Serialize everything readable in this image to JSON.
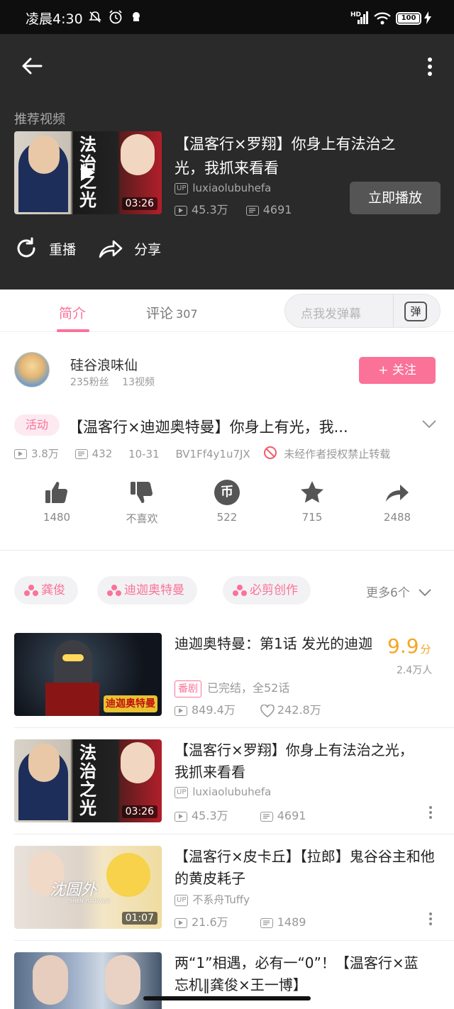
{
  "status_bar": {
    "time": "凌晨4:30",
    "network": "HD",
    "battery": "100"
  },
  "player": {
    "recommended_label": "推荐视频",
    "recommended_video": {
      "title": "【温客行×罗翔】你身上有法治之光，我抓来看看",
      "uploader": "luxiaolubuhefa",
      "views": "45.3万",
      "danmaku": "4691",
      "duration": "03:26",
      "thumb_text": "法治之光"
    },
    "play_now_label": "立即播放",
    "replay_label": "重播",
    "share_label": "分享"
  },
  "tabs": {
    "intro_label": "简介",
    "comments_label": "评论",
    "comments_count": "307",
    "danmaku_placeholder": "点我发弹幕",
    "danmaku_icon_text": "弹"
  },
  "uploader": {
    "name": "硅谷浪味仙",
    "fans": "235粉丝",
    "videos": "13视频",
    "follow_label": "+ 关注"
  },
  "video": {
    "activity_badge": "活动",
    "title": "【温客行×迪迦奥特曼】你身上有光，我...",
    "views": "3.8万",
    "danmaku": "432",
    "date": "10-31",
    "bvid": "BV1Ff4y1u7JX",
    "copyright_note": "未经作者授权禁止转载"
  },
  "actions": {
    "like_count": "1480",
    "dislike_label": "不喜欢",
    "coin_count": "522",
    "coin_symbol": "币",
    "favorite_count": "715",
    "share_count": "2488"
  },
  "tags": {
    "items": [
      "龚俊",
      "迪迦奥特曼",
      "必剪创作"
    ],
    "more_label": "更多6个"
  },
  "related": [
    {
      "title": "迪迦奥特曼：第1话 发光的迪迦",
      "badge": "番剧",
      "status": "已完结，全52话",
      "views": "849.4万",
      "likes": "242.8万",
      "score": "9.9",
      "score_unit": "分",
      "raters": "2.4万人",
      "thumb_text": "迪迦奥特曼"
    },
    {
      "title": "【温客行×罗翔】你身上有法治之光，我抓来看看",
      "uploader": "luxiaolubuhefa",
      "views": "45.3万",
      "danmaku": "4691",
      "duration": "03:26",
      "thumb_text": "法治之光"
    },
    {
      "title": "【温客行×皮卡丘】【拉郎】鬼谷谷主和他的黄皮耗子",
      "uploader": "不系舟Tuffy",
      "views": "21.6万",
      "danmaku": "1489",
      "duration": "01:07",
      "thumb_text": "沈圆外",
      "thumb_subtext": "SHEN YUAN WAI"
    },
    {
      "title": "两“1”相遇，必有一“0”！【温客行×蓝忘机‖龚俊×王一博】"
    }
  ],
  "colors": {
    "accent": "#fb7299",
    "score": "#f5a623"
  }
}
